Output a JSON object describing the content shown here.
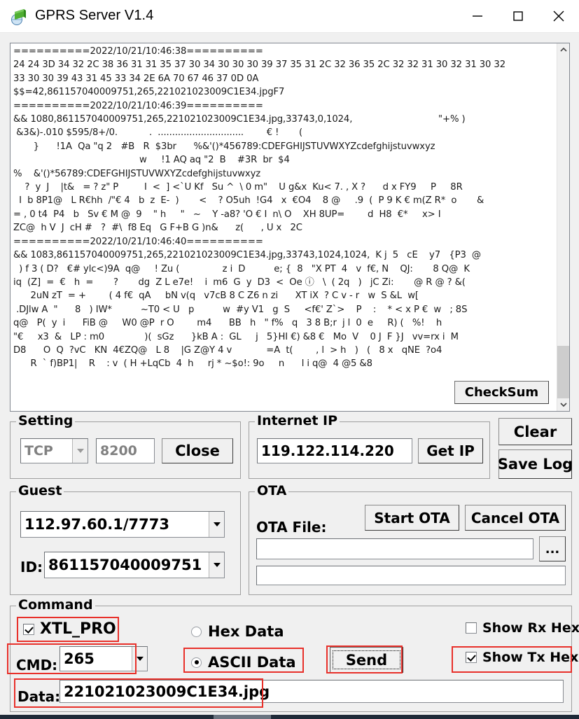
{
  "window": {
    "title": "GPRS Server V1.4",
    "icon": "gprs-app-icon",
    "minimize_label": "–",
    "maximize_label": "□",
    "close_label": "✕"
  },
  "log": {
    "content": "==========2022/10/21/10:46:38==========\n24 24 3D 34 32 2C 38 36 31 31 35 37 30 34 30 30 30 39 37 35 31 2C 32 36 35 2C 32 32 31 30 32 31 30 32\n33 30 30 39 43 31 45 33 34 2E 6A 70 67 46 37 0D 0A\n$$=42,861157040009751,265,221021023009C1E34.jpgF7\n==========2022/10/21/10:46:39==========\n&& 1080,861157040009751,265,221021023009C1E34.jpg,33743,0,1024,                              \"+% )\n &3&)-.010 $595/8+/0.           .  ..............................        € !       (\n       }      !1A  Qa \"q 2   #B   R  $3br      %&'()*456789:CDEFGHIJSTUVWXYZcdefghijstuvwxyz\n                                            w     !1 AQ aq \"2  B    #3R  br  $4\n%    &'()*56789:CDEFGHIJSTUVWXYZcdefghijstuvwxyz\n    ?  y  J    |t&   = ? z\" P         I  <  ] <`U Kf   Su ^  \\ 0 m\"    U g&x  Ku< 7. , X ?      d x FY9     P     8R\n  I  b 8P1@   L R€hh  /\"€ 4   b  z  E-  )       <    ? O5uh  !G4   x  €O4    8 @     .9  (  P 9 K € m(Z R*  o       &\n= , 0 t4  P4   b   Sv € M @  9    \" h     \"   ~    Y -a8? 'O € I  n\\ O    XH 8UP=        d  H8  €*     x> I\nZC@  h V  J  cH #   ?  #\\  f8 Eq   G F+B G )n&      z(      , U x   2C\n==========2022/10/21/10:46:40==========\n&& 1083,861157040009751,265,221021023009C1E34.jpg,33743,1024,1024,  K j  5   cE    y7   {P3  @\n  ) f 3 ( D?   €# ylc<)9A  q@     ! Zu (               z i  D          e; {  8   \"X PT  4   v  f€, N    QJ:       8 Q@  K\niq  (Z]  =  €   h  =       ?       dg  Z L e7e!    i  m6  G  y  D3  <  Oe ⓘ   \\  ( 2q   )   jC Zi:       @ R @ ? &(\n      2uN zT  = +        ( 4 f€  qA     bN v(q   v7cB 8 C Z6 n zi      XT iX  ? C v - r   w  S &L  w[\n .DJlw A  \"      8   ) IW*          ~T0 < U   p          w  #y V1   g  S     <f€' Z`>    P    :    * < x P €  w   ; 8S\nq@   P(  y  i      FiB @     W0 @P  r O        m4      BB   h   \" f%   q   3 8 B;r  j l  0  e     R) (   %!    h\n\"€     x3  &   LP : m0              )(  sGz      }kB A :  GL     j   5}HI €) &8 €   Mo  V    0 J  F }J   vv=rx i  M\nD8      O  Q  ?vC   KN  4€ZQ@   L 8    |G Z@Y 4 v            =A  t(        , l  > h   )   (   8 x   qNE  ?o4\n      R  ` f)BP1|    R    : v  ( H +LqCb  4  h     rj * ~$o!: 9o     n      l i q@  4 @5 &8"
  },
  "checksum_button": {
    "label": "CheckSum"
  },
  "setting": {
    "legend": "Setting",
    "protocol": "TCP",
    "port": "8200",
    "close_label": "Close"
  },
  "internet_ip": {
    "legend": "Internet IP",
    "ip_value": "119.122.114.220",
    "get_ip_label": "Get IP"
  },
  "right_buttons": {
    "clear_label": "Clear",
    "save_log_label": "Save Log"
  },
  "guest": {
    "legend": "Guest",
    "address": "112.97.60.1/7773",
    "id_label": "ID:",
    "id_value": "861157040009751"
  },
  "ota": {
    "legend": "OTA",
    "start_label": "Start OTA",
    "cancel_label": "Cancel OTA",
    "file_label": "OTA File:",
    "file_value": "",
    "browse_label": "...",
    "status_value": ""
  },
  "command": {
    "legend": "Command",
    "xtl_pro_label": "XTL_PRO",
    "xtl_pro_checked": true,
    "cmd_label": "CMD:",
    "cmd_value": "265",
    "hex_data_label": "Hex Data",
    "hex_data_selected": false,
    "ascii_data_label": "ASCII Data",
    "ascii_data_selected": true,
    "send_label": "Send",
    "show_rx_hex_label": "Show Rx Hex",
    "show_rx_hex_checked": false,
    "show_tx_hex_label": "Show Tx Hex",
    "show_tx_hex_checked": true,
    "data_label": "Data:",
    "data_value": "221021023009C1E34.jpg"
  },
  "colors": {
    "annotation": "#e8302a",
    "window_background": "#f0f0f0",
    "field_background": "#ffffff"
  }
}
